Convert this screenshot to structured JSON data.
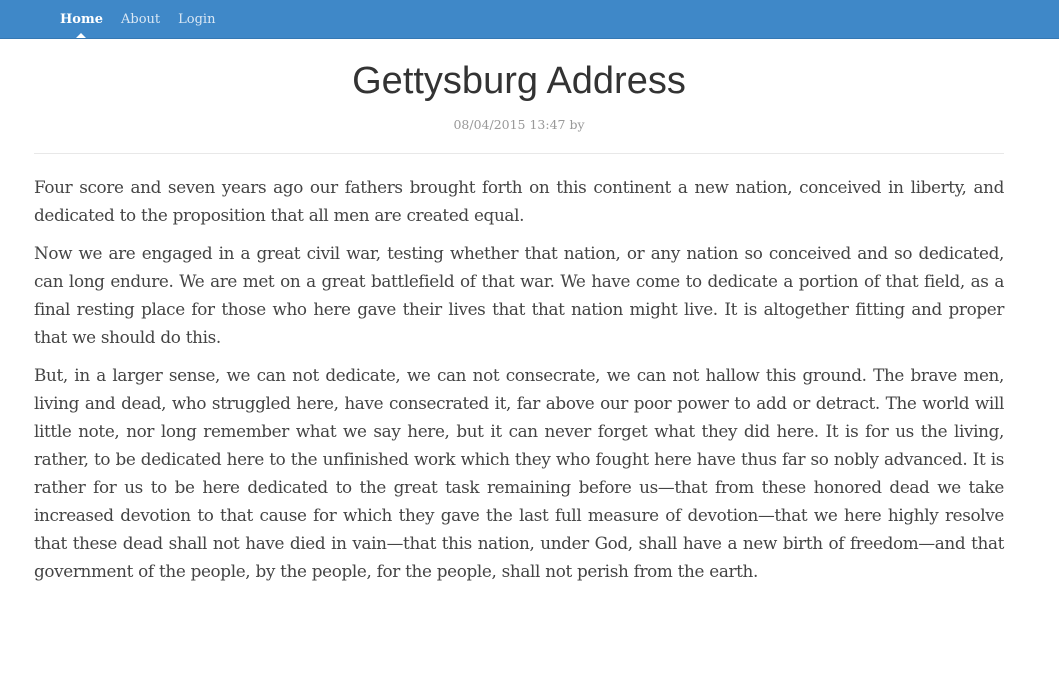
{
  "nav": {
    "items": [
      {
        "label": "Home",
        "active": true
      },
      {
        "label": "About",
        "active": false
      },
      {
        "label": "Login",
        "active": false
      }
    ]
  },
  "article": {
    "title": "Gettysburg Address",
    "meta": "08/04/2015 13:47 by",
    "paragraphs": [
      "Four score and seven years ago our fathers brought forth on this continent a new nation, conceived in liberty, and dedicated to the proposition that all men are created equal.",
      "Now we are engaged in a great civil war, testing whether that nation, or any nation so conceived and so dedicated, can long endure. We are met on a great battlefield of that war. We have come to dedicate a portion of that field, as a final resting place for those who here gave their lives that that nation might live. It is altogether fitting and proper that we should do this.",
      "But, in a larger sense, we can not dedicate, we can not consecrate, we can not hallow this ground. The brave men, living and dead, who struggled here, have consecrated it, far above our poor power to add or detract. The world will little note, nor long remember what we say here, but it can never forget what they did here. It is for us the living, rather, to be dedicated here to the unfinished work which they who fought here have thus far so nobly advanced. It is rather for us to be here dedicated to the great task remaining before us—that from these honored dead we take increased devotion to that cause for which they gave the last full measure of devotion—that we here highly resolve that these dead shall not have died in vain—that this nation, under God, shall have a new birth of freedom—and that government of the people, by the people, for the people, shall not perish from the earth."
    ]
  },
  "colors": {
    "navbar": "#3f88c8",
    "nav_text": "#d9e7f4",
    "nav_active": "#ffffff",
    "title": "#333333",
    "meta": "#999999",
    "body_text": "#444444"
  }
}
